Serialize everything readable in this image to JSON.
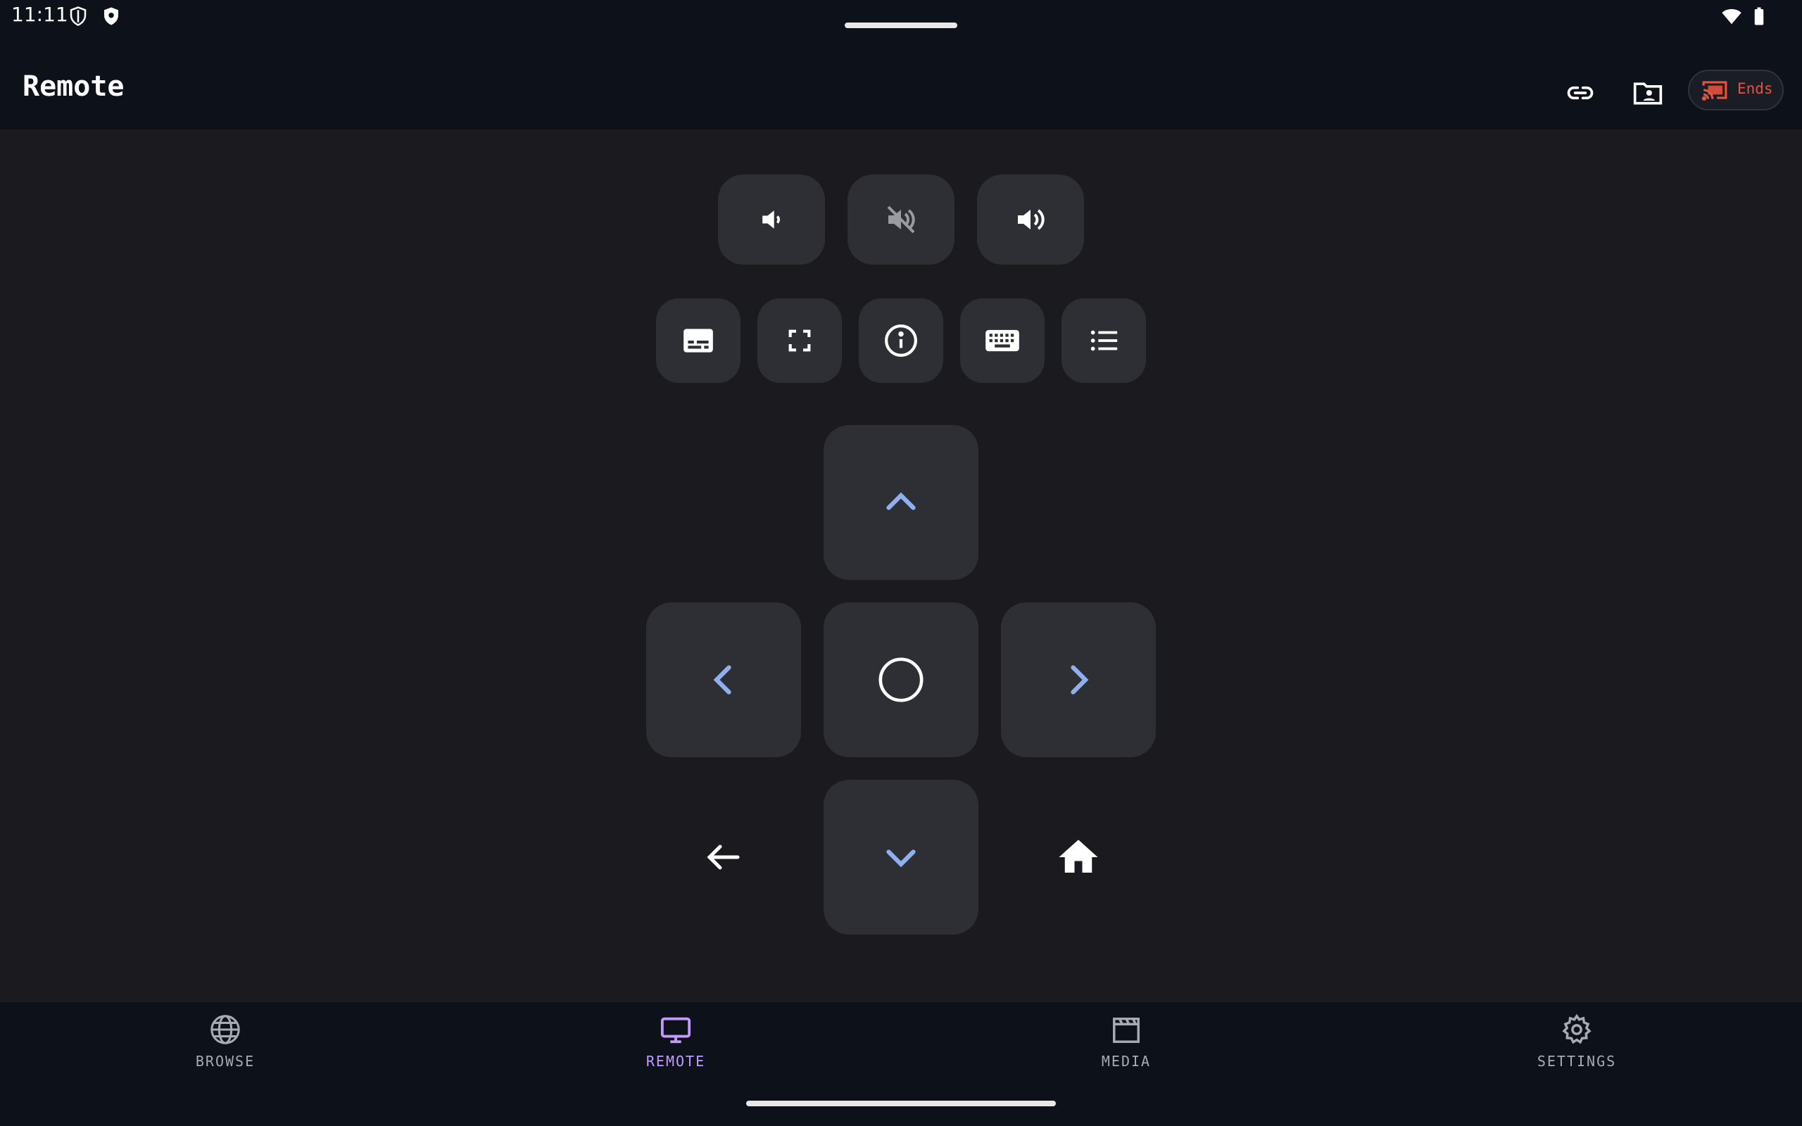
{
  "status_bar": {
    "time": "11:11",
    "icons": [
      "shield-outline-icon",
      "shield-filled-icon",
      "wifi-icon",
      "battery-icon"
    ]
  },
  "app_bar": {
    "title": "Remote",
    "actions": [
      "link-icon",
      "folder-account-icon"
    ],
    "cast": {
      "icon": "cast-connected-icon",
      "label": "Ends",
      "color": "#e5533d"
    }
  },
  "volume_row": [
    "volume-down-icon",
    "volume-mute-icon",
    "volume-up-icon"
  ],
  "function_row": [
    "subtitles-icon",
    "fullscreen-icon",
    "info-icon",
    "keyboard-icon",
    "list-icon"
  ],
  "dpad": {
    "up": "chevron-up-icon",
    "down": "chevron-down-icon",
    "left": "chevron-left-icon",
    "right": "chevron-right-icon",
    "center": "circle-select-icon",
    "back": "arrow-back-icon",
    "home": "home-icon",
    "accent": "#8fb0ee"
  },
  "bottom_nav": {
    "items": [
      {
        "label": "BROWSE",
        "icon": "globe-icon",
        "active": false
      },
      {
        "label": "REMOTE",
        "icon": "tv-icon",
        "active": true
      },
      {
        "label": "MEDIA",
        "icon": "clapperboard-icon",
        "active": false
      },
      {
        "label": "SETTINGS",
        "icon": "gear-icon",
        "active": false
      }
    ],
    "active_color": "#c39bff"
  }
}
